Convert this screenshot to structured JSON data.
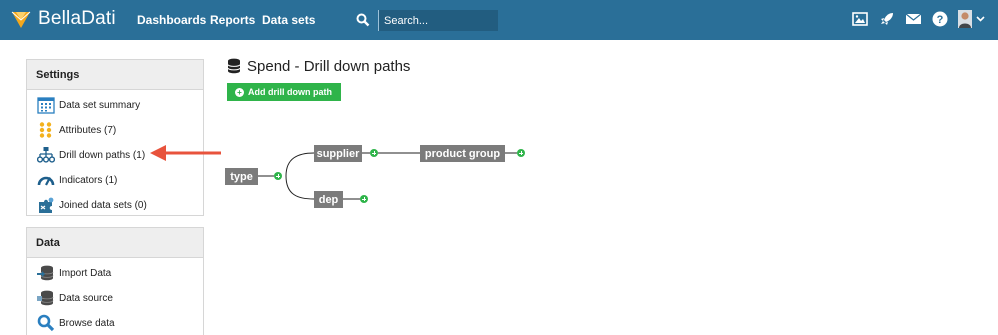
{
  "app": {
    "name": "BellaDati",
    "nav": [
      "Dashboards",
      "Reports",
      "Data sets"
    ],
    "search_placeholder": "Search..."
  },
  "topbar_icons": [
    "image-icon",
    "rocket-icon",
    "mail-icon",
    "help-icon",
    "user-menu-icon"
  ],
  "settings": {
    "title": "Settings",
    "items": [
      {
        "label": "Data set summary",
        "icon": "calendar-grid-icon"
      },
      {
        "label": "Attributes (7)",
        "icon": "attributes-dots-icon"
      },
      {
        "label": "Drill down paths (1)",
        "icon": "hierarchy-icon"
      },
      {
        "label": "Indicators (1)",
        "icon": "gauge-icon"
      },
      {
        "label": "Joined data sets (0)",
        "icon": "puzzle-icon"
      }
    ]
  },
  "data": {
    "title": "Data",
    "items": [
      {
        "label": "Import Data",
        "icon": "database-import-icon"
      },
      {
        "label": "Data source",
        "icon": "database-icon"
      },
      {
        "label": "Browse data",
        "icon": "search-icon"
      }
    ]
  },
  "main": {
    "title": "Spend - Drill down paths",
    "add_button": "Add drill down path"
  },
  "drill_tree": {
    "root": "type",
    "nodes": [
      "supplier",
      "product group",
      "dep"
    ]
  },
  "colors": {
    "topbar": "#2a6f98",
    "accent_green": "#2fb44a",
    "node_gray": "#7b7b7b",
    "arrow_red": "#e8533c"
  }
}
